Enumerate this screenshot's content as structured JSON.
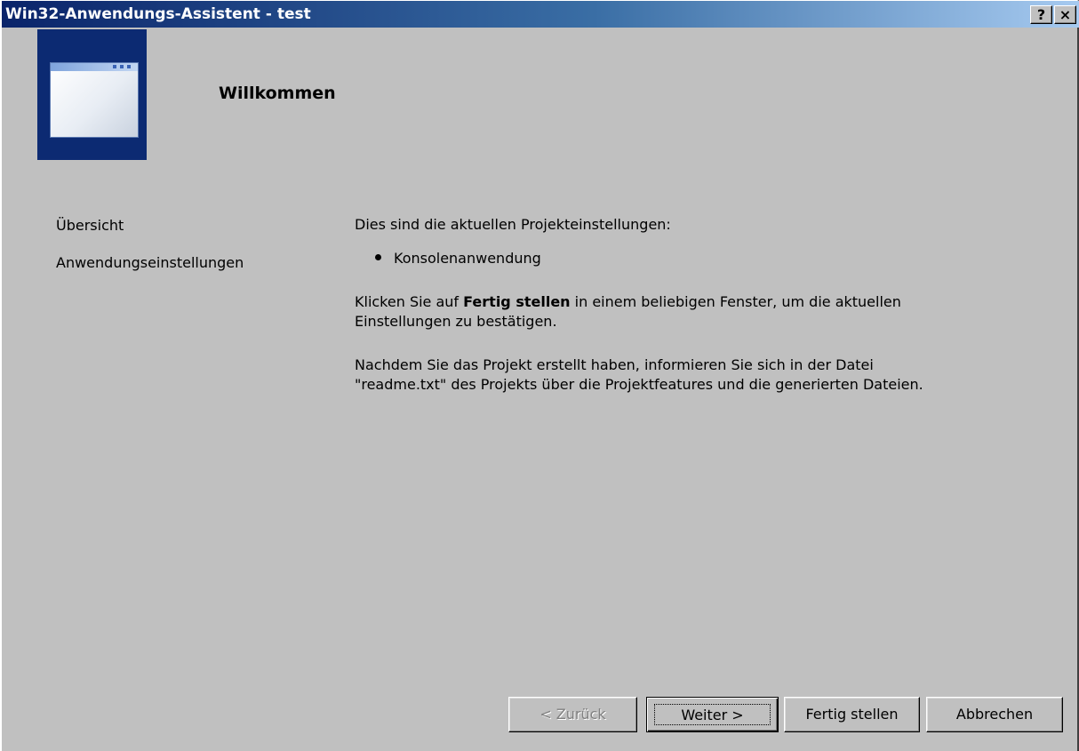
{
  "window": {
    "title": "Win32-Anwendungs-Assistent - test",
    "help_label": "?",
    "close_label": "×"
  },
  "header": {
    "title": "Willkommen"
  },
  "sidebar": {
    "items": [
      {
        "label": "Übersicht"
      },
      {
        "label": "Anwendungseinstellungen"
      }
    ]
  },
  "content": {
    "intro": "Dies sind die aktuellen Projekteinstellungen:",
    "bullets": [
      "Konsolenanwendung"
    ],
    "para1_prefix": "Klicken Sie auf ",
    "para1_bold": "Fertig stellen",
    "para1_suffix": " in einem beliebigen Fenster, um die aktuellen",
    "para1_line2": "Einstellungen zu bestätigen.",
    "para2_line1": "Nachdem Sie das Projekt erstellt haben, informieren Sie sich in der Datei",
    "para2_line2": "\"readme.txt\" des Projekts über die Projektfeatures und die generierten Dateien."
  },
  "buttons": {
    "back": "< Zurück",
    "next": "Weiter >",
    "finish": "Fertig stellen",
    "cancel": "Abbrechen"
  },
  "colors": {
    "titlebar_start": "#0a246a",
    "titlebar_end": "#a6caf0",
    "dialog_bg": "#c0c0c0",
    "icon_frame": "#0c2a72"
  }
}
